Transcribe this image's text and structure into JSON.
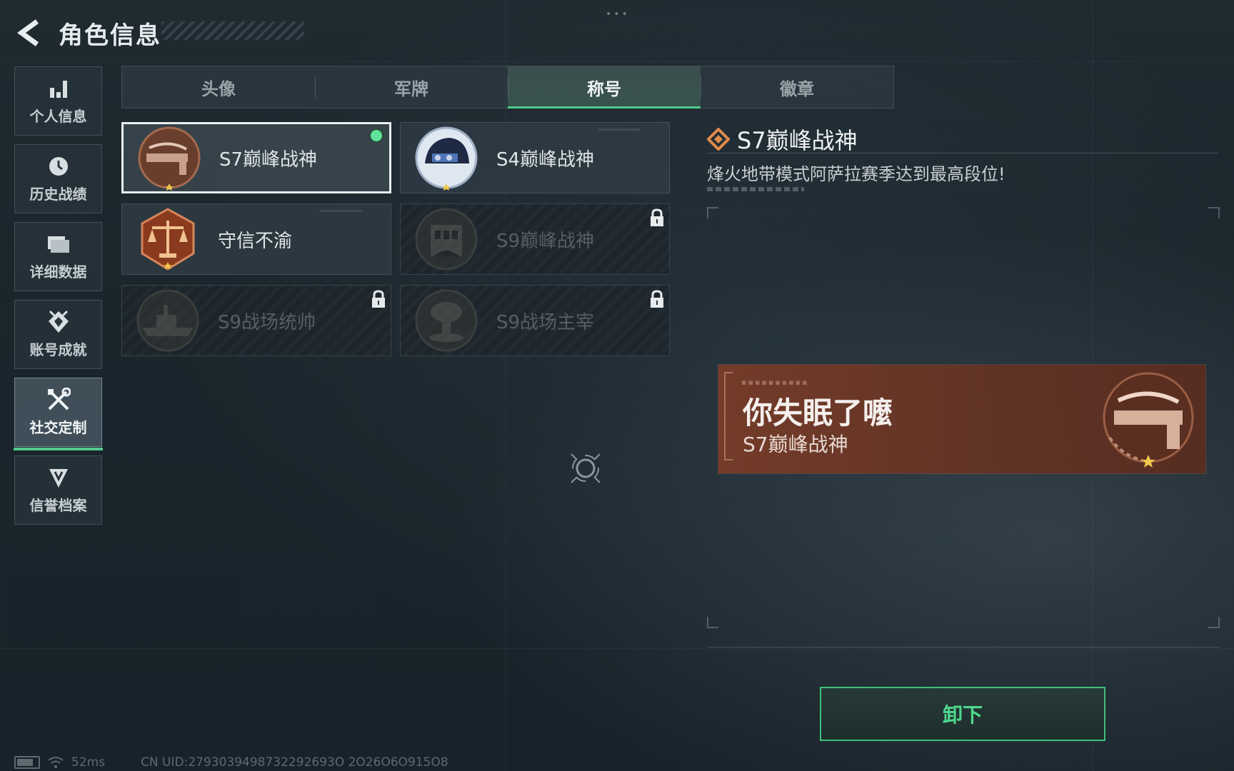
{
  "header": {
    "title": "角色信息"
  },
  "sidenav": [
    {
      "label": "个人信息",
      "icon": "bar-chart-icon",
      "active": false
    },
    {
      "label": "历史战绩",
      "icon": "history-clock-icon",
      "active": false
    },
    {
      "label": "详细数据",
      "icon": "folder-icon",
      "active": false
    },
    {
      "label": "账号成就",
      "icon": "achievement-icon",
      "active": false
    },
    {
      "label": "社交定制",
      "icon": "tools-icon",
      "active": true
    },
    {
      "label": "信誉档案",
      "icon": "shield-badge-icon",
      "active": false
    }
  ],
  "tabs": [
    {
      "label": "头像",
      "active": false
    },
    {
      "label": "军牌",
      "active": false
    },
    {
      "label": "称号",
      "active": true
    },
    {
      "label": "徽章",
      "active": false
    }
  ],
  "titles": [
    {
      "label": "S7巅峰战神",
      "emblem": "rifle-emblem-icon",
      "selected": true,
      "equipped": true,
      "locked": false
    },
    {
      "label": "S4巅峰战神",
      "emblem": "helmet-emblem-icon",
      "selected": false,
      "equipped": false,
      "locked": false
    },
    {
      "label": "守信不渝",
      "emblem": "scales-emblem-icon",
      "selected": false,
      "equipped": false,
      "locked": false
    },
    {
      "label": "S9巅峰战神",
      "emblem": "building-emblem-icon",
      "selected": false,
      "equipped": false,
      "locked": true
    },
    {
      "label": "S9战场统帅",
      "emblem": "warship-emblem-icon",
      "selected": false,
      "equipped": false,
      "locked": true
    },
    {
      "label": "S9战场主宰",
      "emblem": "mushroom-cloud-emblem-icon",
      "selected": false,
      "equipped": false,
      "locked": true
    }
  ],
  "detail": {
    "title": "S7巅峰战神",
    "description": "烽火地带模式阿萨拉赛季达到最高段位!"
  },
  "banner": {
    "player_name": "你失眠了嚒",
    "title": "S7巅峰战神"
  },
  "actions": {
    "unequip_label": "卸下"
  },
  "footer": {
    "ping": "52ms",
    "uid": "CN UID:2793039498732292693O 2O26O6O915O8"
  },
  "colors": {
    "accent_green": "#4ec98a",
    "equipped_dot": "#5fe39a",
    "banner_bg": "#6e3a28",
    "diamond_orange": "#e08a4a"
  }
}
